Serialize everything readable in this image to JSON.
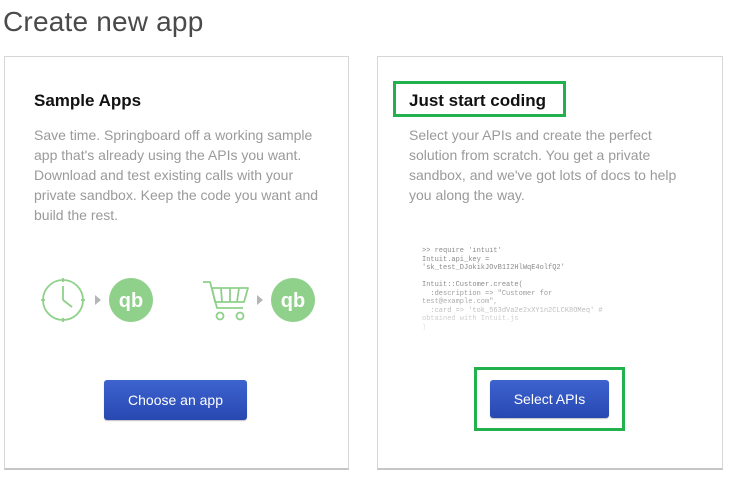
{
  "page": {
    "title": "Create new app"
  },
  "sample_apps": {
    "title": "Sample Apps",
    "description": "Save time. Springboard off a working sample app that's already using the APIs you want. Download and test existing calls with your private sandbox. Keep the code you want and build the rest.",
    "button_label": "Choose an app",
    "icons": [
      "clock-icon",
      "arrow-right-icon",
      "quickbooks-logo-icon",
      "shopping-cart-icon",
      "arrow-right-icon",
      "quickbooks-logo-icon"
    ]
  },
  "just_start_coding": {
    "title": "Just start coding",
    "description": "Select your APIs and create the perfect solution from scratch. You get a private sandbox, and we've got lots of docs to help you along the way.",
    "button_label": "Select APIs",
    "code_sample": ">> require 'intuit'\nIntuit.api_key =\n'sk_test_DJokikJOvB1I2HlWqE4olfQ2'\n\nIntuit::Customer.create(\n  :description => \"Customer for\ntest@example.com\",\n  :card => 'tok_563dVa2e2xXY1n2CLCK8OMeq' #\nobtained with Intuit.js\n)"
  },
  "colors": {
    "highlight": "#22b14c",
    "button": "#2d4fbd",
    "icon_green": "#8fd08a"
  }
}
